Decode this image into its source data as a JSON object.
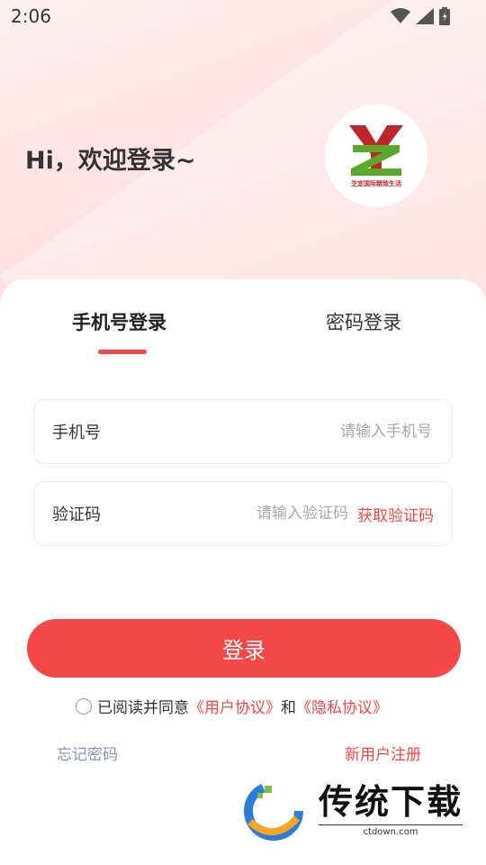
{
  "status": {
    "time": "2:06"
  },
  "header": {
    "greeting": "Hi，欢迎登录~",
    "logo_caption": "芝宜国际精致生活"
  },
  "tabs": [
    {
      "label": "手机号登录",
      "active": true
    },
    {
      "label": "密码登录",
      "active": false
    }
  ],
  "form": {
    "phone": {
      "label": "手机号",
      "placeholder": "请输入手机号",
      "value": ""
    },
    "code": {
      "label": "验证码",
      "placeholder": "请输入验证码",
      "value": "",
      "action": "获取验证码"
    }
  },
  "login_button": "登录",
  "agreement": {
    "prefix": "已阅读并同意",
    "user_agreement": "《用户协议》",
    "conjunction": "和",
    "privacy_agreement": "《隐私协议》",
    "checked": false
  },
  "links": {
    "forgot": "忘记密码",
    "register": "新用户注册"
  },
  "watermark": {
    "title": "传统下载",
    "subtitle": "ctdown.com"
  },
  "colors": {
    "accent": "#f54848",
    "link_gray": "#8a93a8",
    "logo_green": "#5aaa2a",
    "logo_red": "#c0272d"
  }
}
